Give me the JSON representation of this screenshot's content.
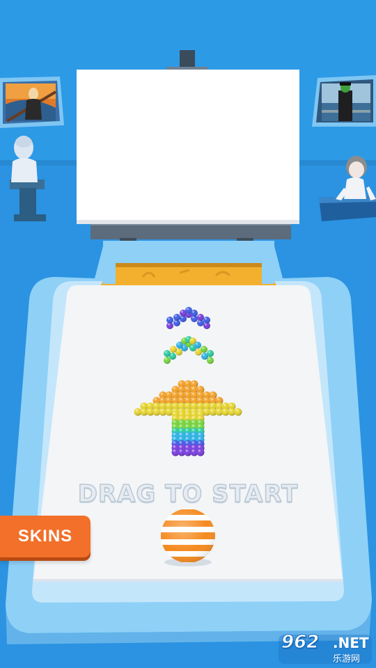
{
  "hud": {
    "instruction": "DRAG TO START",
    "skins_label": "SKINS"
  },
  "watermark": {
    "number": "962",
    "suffix": ".NET",
    "subtitle": "乐游网"
  },
  "colors": {
    "background": "#2d9ae6",
    "floor": "#2a8fdc",
    "table_frame": "#8fd0f7",
    "table_surface": "#f3f5f7",
    "skins_button": "#f2702a",
    "drop_zone": "#f3b02e",
    "ball_orange": "#f58a1f",
    "ball_white": "#ffffff"
  },
  "scene": {
    "canvas": "white-canvas",
    "left_painting": "scream-painting",
    "right_painting": "son-of-man-painting",
    "left_statue": "bust-statue",
    "right_statue": "girl-statue",
    "bead_colors": [
      "#7a3fe0",
      "#3f5ee8",
      "#2fb4e8",
      "#2ecfa2",
      "#7ad640",
      "#e8d632",
      "#f5a32a"
    ],
    "player_ball": "striped-ball"
  }
}
